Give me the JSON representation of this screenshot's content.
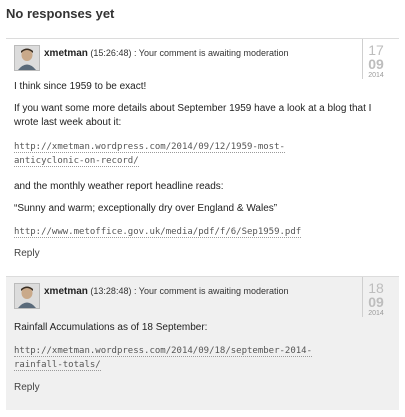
{
  "heading": "No responses yet",
  "comments": [
    {
      "author": "xmetman",
      "time": "(15:26:48)",
      "moderation": ": Your comment is awaiting moderation",
      "date": {
        "day": "17",
        "month": "09",
        "year": "2014"
      },
      "paragraphs": [
        "I think since 1959 to be exact!",
        "If you want some more details about September 1959 have a look at a blog that I wrote last week about it:"
      ],
      "link1_line1": "http://xmetman.wordpress.com/2014/09/12/1959-most-",
      "link1_line2": "anticyclonic-on-record/",
      "para3": "and the monthly weather report headline reads:",
      "quote": "“Sunny and warm; exceptionally dry over England & Wales”",
      "link2": "http://www.metoffice.gov.uk/media/pdf/f/6/Sep1959.pdf",
      "reply": "Reply"
    },
    {
      "author": "xmetman",
      "time": "(13:28:48)",
      "moderation": ": Your comment is awaiting moderation",
      "date": {
        "day": "18",
        "month": "09",
        "year": "2014"
      },
      "para1": "Rainfall Accumulations as of 18 September:",
      "link1_line1": "http://xmetman.wordpress.com/2014/09/18/september-2014-",
      "link1_line2": "rainfall-totals/",
      "reply": "Reply"
    }
  ]
}
